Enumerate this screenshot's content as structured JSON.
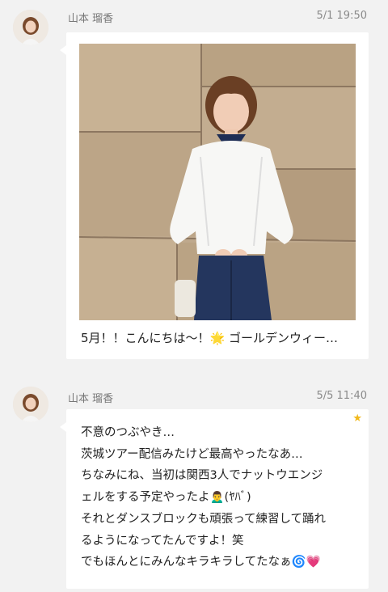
{
  "messages": [
    {
      "sender": "山本 瑠香",
      "time": "5/1 19:50",
      "caption": "5月！！こんにちは〜！🌟 ゴールデンウィー…"
    },
    {
      "sender": "山本 瑠香",
      "time": "5/5 11:40",
      "text": "不意のつぶやき…\n茨城ツアー配信みたけど最高やったなあ…\nちなみにね、当初は関西3人でナットウエンジ\nェルをする予定やったよ🙍‍♂️(ﾔﾊﾞ)\nそれとダンスブロックも頑張って練習して踊れ\nるようになってたんですよ！笑\nでもほんとにみんなキラキラしてたなぁ🌀💗",
      "starred": true
    }
  ],
  "colors": {
    "background": "#f2f2f2",
    "bubble": "#ffffff",
    "star": "#f1b81a"
  }
}
